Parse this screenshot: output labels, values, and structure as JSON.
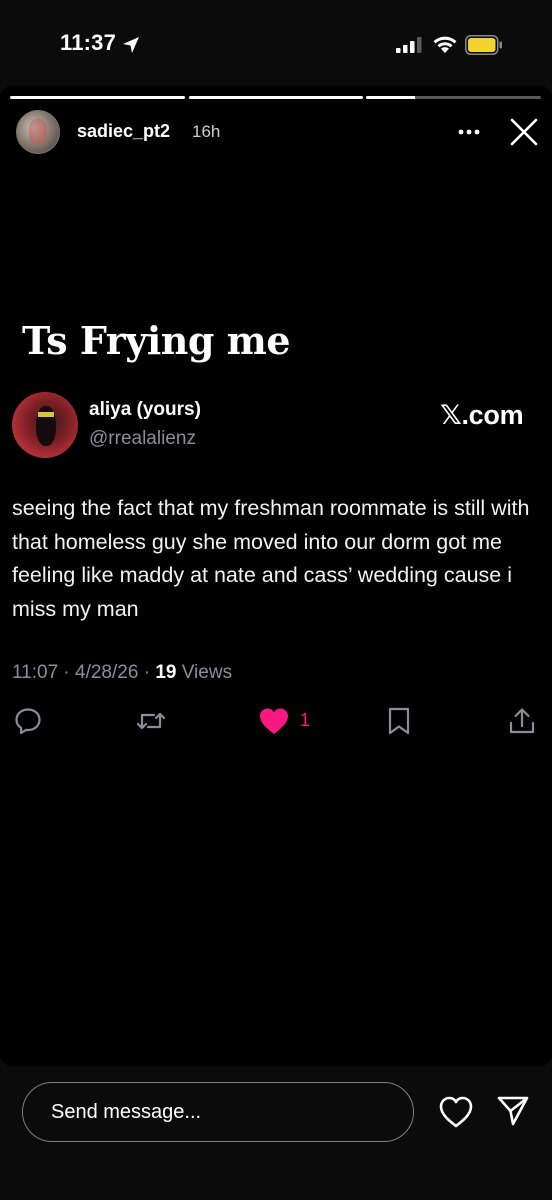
{
  "status_bar": {
    "time": "11:37",
    "battery_color": "#f2d22e"
  },
  "story": {
    "username": "sadiec_pt2",
    "time_ago": "16h",
    "caption": "Ts Frying me",
    "progress": [
      1.0,
      1.0,
      0.28
    ]
  },
  "tweet": {
    "display_name": "aliya (yours)",
    "handle": "@rrealalienz",
    "brand": ".com",
    "brand_glyph": "𝕏",
    "text": "seeing the fact that my freshman roommate is still with that homeless guy she moved into our dorm got me feeling like maddy at nate and cass’ wedding cause i miss my man",
    "timestamp": "11:07 · 4/28/26 · ",
    "views_count": "19",
    "views_label": " Views",
    "like_count": "1",
    "like_color": "#f91880"
  },
  "composer": {
    "placeholder": "Send message..."
  }
}
